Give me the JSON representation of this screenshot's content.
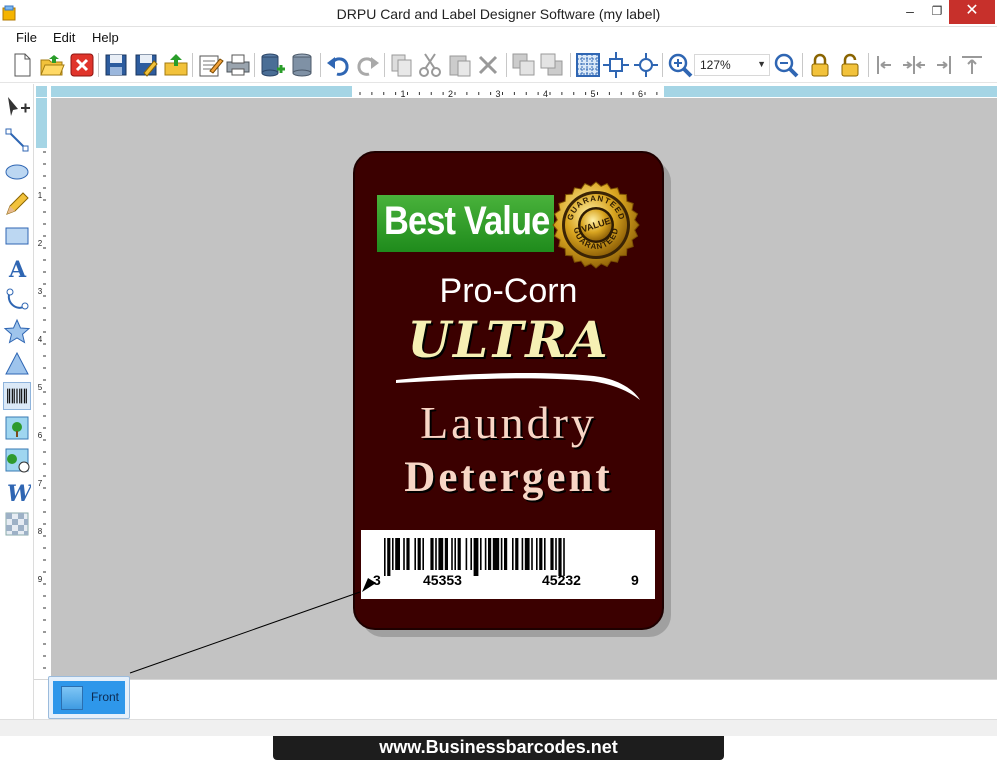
{
  "window": {
    "title": "DRPU Card and Label Designer Software  (my label)",
    "minimize_glyph": "–",
    "maximize_glyph": "❐",
    "close_glyph": "✕"
  },
  "menu": {
    "file": "File",
    "edit": "Edit",
    "help": "Help"
  },
  "toolbar": {
    "zoom_value": "127%",
    "icons": [
      "new-icon",
      "open-icon",
      "close-icon",
      "save-icon",
      "save-as-icon",
      "export-icon",
      "properties-icon",
      "print-icon",
      "database-add-icon",
      "database-icon",
      "undo-icon",
      "redo-icon",
      "copy-icon",
      "cut-icon",
      "paste-icon",
      "delete-icon",
      "bring-front-icon",
      "send-back-icon",
      "grid-icon",
      "center-icon",
      "fit-icon",
      "zoom-in-icon",
      "zoom-out-icon",
      "lock-icon",
      "unlock-icon",
      "align-left-icon",
      "align-center-icon",
      "align-right-icon",
      "align-top-icon"
    ]
  },
  "tools": [
    "select-tool",
    "line-tool",
    "ellipse-tool",
    "pencil-tool",
    "rectangle-tool",
    "text-tool",
    "curve-tool",
    "star-tool",
    "triangle-tool",
    "barcode-tool",
    "image-tool",
    "picture-library-tool",
    "wordart-tool",
    "watermark-tool"
  ],
  "rulers": {
    "horizontal_numbers": [
      "1",
      "2",
      "3",
      "4",
      "5",
      "6"
    ],
    "vertical_numbers": [
      "1",
      "2",
      "3",
      "4",
      "5",
      "6",
      "7",
      "8",
      "9"
    ]
  },
  "label": {
    "badge_text": "Best Value",
    "seal_top": "GUARANTEED",
    "seal_center": "VALUE",
    "seal_bottom": "GUARANTEED",
    "line1": "Pro-Corn",
    "line2": "ULTRA",
    "line3": "Laundry",
    "line4": "Detergent",
    "barcode": {
      "digit_first": "3",
      "group_left": "45353",
      "group_right": "45232",
      "digit_last": "9"
    },
    "colors": {
      "card_background": "#3b0000",
      "badge_green": "#2f9e28",
      "seal_gold": "#d4a017"
    }
  },
  "pages": {
    "front_tab": "Front"
  },
  "footer": {
    "site": "www.Businessbarcodes.net"
  }
}
